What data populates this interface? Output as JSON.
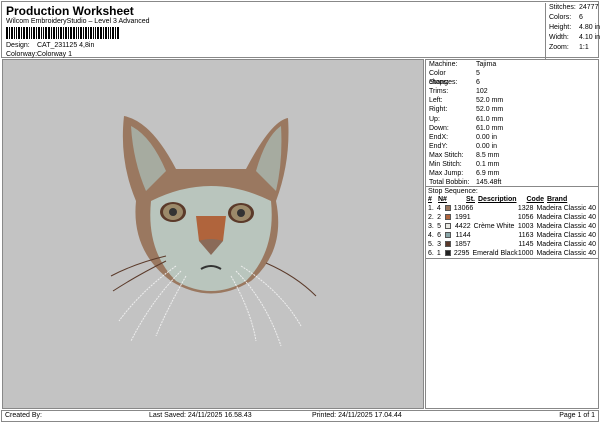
{
  "header": {
    "title": "Production Worksheet",
    "subtitle": "Wilcom EmbroideryStudio – Level 3 Advanced",
    "design_label": "Design:",
    "design_value": "CAT_231125 4,8in",
    "colorway_label": "Colorway:",
    "colorway_value": "Colorway 1"
  },
  "stats": [
    {
      "k": "Stitches:",
      "v": "24777"
    },
    {
      "k": "Colors:",
      "v": "6"
    },
    {
      "k": "Height:",
      "v": "4.80 in"
    },
    {
      "k": "Width:",
      "v": "4.10 in"
    },
    {
      "k": "Zoom:",
      "v": "1:1"
    }
  ],
  "info": [
    {
      "k": "Machine:",
      "v": "Tajima"
    },
    {
      "k": "Color changes:",
      "v": "5"
    },
    {
      "k": "Stops:",
      "v": "6"
    },
    {
      "k": "Trims:",
      "v": "102"
    },
    {
      "k": "Left:",
      "v": "52.0 mm"
    },
    {
      "k": "Right:",
      "v": "52.0 mm"
    },
    {
      "k": "Up:",
      "v": "61.0 mm"
    },
    {
      "k": "Down:",
      "v": "61.0 mm"
    },
    {
      "k": "EndX:",
      "v": "0.00 in"
    },
    {
      "k": "EndY:",
      "v": "0.00 in"
    },
    {
      "k": "Max Stitch:",
      "v": "8.5 mm"
    },
    {
      "k": "Min Stitch:",
      "v": "0.1 mm"
    },
    {
      "k": "Max Jump:",
      "v": "6.9 mm"
    },
    {
      "k": "Total Bobbin:",
      "v": "145.48ft"
    }
  ],
  "stop_sequence": {
    "title": "Stop Sequence:",
    "headers": [
      "#",
      "N#",
      "St.",
      "Description",
      "Code",
      "Brand"
    ],
    "rows": [
      {
        "num": "1.",
        "n": "4",
        "color": "#9a7860",
        "st": "13066",
        "desc": "",
        "code": "1328",
        "brand": "Madeira Classic 40"
      },
      {
        "num": "2.",
        "n": "2",
        "color": "#b0643c",
        "st": "1991",
        "desc": "",
        "code": "1056",
        "brand": "Madeira Classic 40"
      },
      {
        "num": "3.",
        "n": "5",
        "color": "#e8e8e2",
        "st": "4422",
        "desc": "Crème White",
        "code": "1003",
        "brand": "Madeira Classic 40"
      },
      {
        "num": "4.",
        "n": "6",
        "color": "#8aa6a8",
        "st": "1144",
        "desc": "",
        "code": "1163",
        "brand": "Madeira Classic 40"
      },
      {
        "num": "5.",
        "n": "3",
        "color": "#5b3a2a",
        "st": "1857",
        "desc": "",
        "code": "1145",
        "brand": "Madeira Classic 40"
      },
      {
        "num": "6.",
        "n": "1",
        "color": "#222222",
        "st": "2295",
        "desc": "Emerald Black",
        "code": "1000",
        "brand": "Madeira Classic 40"
      }
    ]
  },
  "footer": {
    "created": "Created By:",
    "saved": "Last Saved: 24/11/2025 16.58.43",
    "printed": "Printed: 24/11/2025 17.04.44",
    "page": "Page 1 of 1"
  }
}
